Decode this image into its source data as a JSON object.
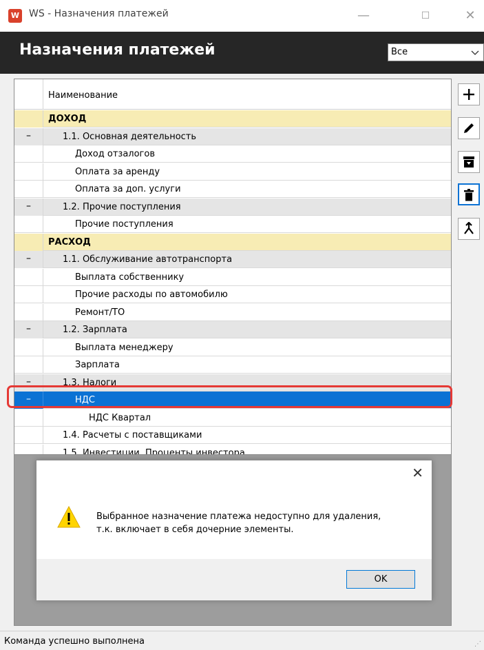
{
  "window": {
    "app_icon_letter": "W",
    "title": "WS - Назначения платежей",
    "minimize_glyph": "—",
    "maximize_glyph": "☐",
    "close_glyph": "✕"
  },
  "header": {
    "title": "Назначения платежей",
    "filter_value": "Все"
  },
  "table": {
    "column_name": "Наименование",
    "rows": [
      {
        "marker": "",
        "label": "ДОХОД",
        "level": 0
      },
      {
        "marker": "–",
        "label": "1.1. Основная деятельность",
        "level": 1
      },
      {
        "marker": "",
        "label": "Доход отзалогов",
        "level": 2
      },
      {
        "marker": "",
        "label": "Оплата за аренду",
        "level": 2
      },
      {
        "marker": "",
        "label": "Оплата за доп. услуги",
        "level": 2
      },
      {
        "marker": "–",
        "label": "1.2. Прочие поступления",
        "level": 1
      },
      {
        "marker": "",
        "label": "Прочие поступления",
        "level": 2
      },
      {
        "marker": "",
        "label": "РАСХОД",
        "level": 0
      },
      {
        "marker": "–",
        "label": "1.1. Обслуживание автотранспорта",
        "level": 1
      },
      {
        "marker": "",
        "label": "Выплата собственнику",
        "level": 2
      },
      {
        "marker": "",
        "label": "Прочие расходы по автомобилю",
        "level": 2
      },
      {
        "marker": "",
        "label": "Ремонт/ТО",
        "level": 2
      },
      {
        "marker": "–",
        "label": "1.2. Зарплата",
        "level": 1
      },
      {
        "marker": "",
        "label": "Выплата менеджеру",
        "level": 2
      },
      {
        "marker": "",
        "label": "Зарплата",
        "level": 2
      },
      {
        "marker": "–",
        "label": "1.3. Налоги",
        "level": 1
      },
      {
        "marker": "–",
        "label": "НДС",
        "level": 2,
        "selected": true
      },
      {
        "marker": "",
        "label": "НДС Квартал",
        "level": 3
      },
      {
        "marker": "",
        "label": "1.4. Расчеты с поставщиками",
        "level": 1
      },
      {
        "marker": "",
        "label": "1.5. Инвестиции. Проценты инвестора",
        "level": 1
      }
    ]
  },
  "toolbar": {
    "icons": [
      "add-icon",
      "edit-icon",
      "archive-icon",
      "delete-icon",
      "merge-icon"
    ]
  },
  "dialog": {
    "close_glyph": "✕",
    "message_line1": "Выбранное назначение платежа недоступно для удаления,",
    "message_line2": "т.к. включает в себя дочерние элементы.",
    "ok_label": "OK"
  },
  "status": {
    "text": "Команда успешно выполнена",
    "grip": "⋰"
  },
  "colors": {
    "header_bg": "#262626",
    "group_bg": "#f7ecb4",
    "subgroup_bg": "#e5e5e5",
    "selected_bg": "#0b72d4",
    "highlight_border": "#e53935"
  }
}
